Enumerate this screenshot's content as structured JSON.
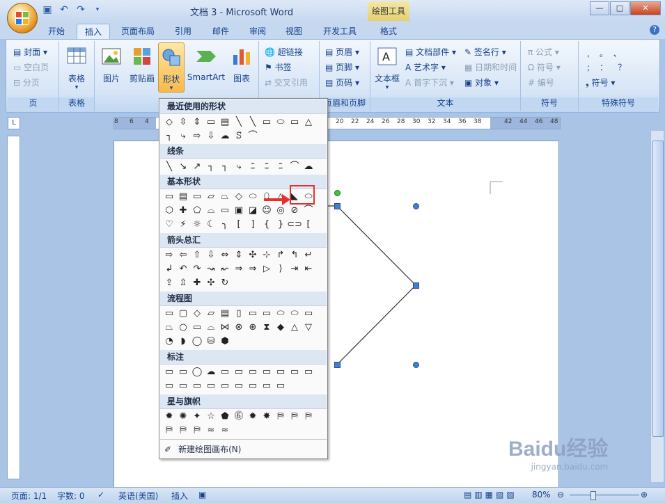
{
  "window": {
    "title": "文档 3 - Microsoft Word",
    "context_tab": "绘图工具"
  },
  "ribbon_tabs": [
    "开始",
    "插入",
    "页面布局",
    "引用",
    "邮件",
    "审阅",
    "视图",
    "开发工具",
    "格式"
  ],
  "ribbon": {
    "groups": {
      "pages": {
        "label": "页",
        "items": [
          "封面",
          "空白页",
          "分页"
        ]
      },
      "tables": {
        "label": "表格",
        "button": "表格"
      },
      "illustrations": {
        "buttons": [
          "图片",
          "剪贴画",
          "形状",
          "SmartArt",
          "图表"
        ]
      },
      "links": {
        "items": [
          "超链接",
          "书签",
          "交叉引用"
        ]
      },
      "header_footer": {
        "label": "页眉和页脚",
        "items": [
          "页眉",
          "页脚",
          "页码"
        ]
      },
      "text": {
        "label": "文本",
        "button": "文本框",
        "items": [
          "文档部件",
          "艺术字",
          "首字下沉",
          "签名行",
          "日期和时间",
          "对象"
        ]
      },
      "symbols": {
        "label": "符号",
        "items": [
          "公式",
          "符号",
          "编号"
        ]
      },
      "special": {
        "label": "特殊符号",
        "chars": [
          ",",
          "。",
          "、",
          ";",
          "：",
          "？"
        ],
        "button": "符号"
      }
    }
  },
  "ruler": {
    "numbers": [
      "8",
      "6",
      "4",
      "20",
      "22",
      "24",
      "26",
      "28",
      "30",
      "32",
      "34",
      "36",
      "38",
      "42",
      "44",
      "46",
      "48"
    ]
  },
  "shapes_menu": {
    "sections": [
      "最近使用的形状",
      "线条",
      "基本形状",
      "箭头总汇",
      "流程图",
      "标注",
      "星与旗帜"
    ],
    "recent": [
      "◇",
      "⇳",
      "⇕",
      "▭",
      "▤",
      "╲",
      "╲",
      "▭",
      "⬭",
      "▭",
      "△",
      "┐",
      "⤷",
      "⇨",
      "⇩",
      "☁",
      "ꕶ",
      "⌒"
    ],
    "lines": [
      "╲",
      "↘",
      "↗",
      "┐",
      "┐",
      "⤷",
      "ﾆ",
      "ﾆ",
      "ﾆ",
      "⌒",
      "☁",
      "ꕶ"
    ],
    "basic": [
      "▭",
      "▤",
      "▭",
      "▱",
      "⏢",
      "◇",
      "⬭",
      "⬯",
      "△",
      "◣",
      "⬭",
      "⬡",
      "✚",
      "⬠",
      "⌓",
      "▭",
      "▣",
      "◪",
      "☺",
      "◎",
      "⊘",
      "⌒",
      "♡",
      "⚡",
      "☼",
      "☾",
      "╮",
      "[",
      "]",
      "{",
      "}",
      "⊂⊃",
      "[",
      "]",
      "{",
      "}"
    ],
    "arrows": [
      "⇨",
      "⇦",
      "⇧",
      "⇩",
      "⇔",
      "⇕",
      "✣",
      "⊹",
      "↱",
      "↰",
      "↵",
      "↲",
      "↶",
      "↷",
      "↝",
      "↜",
      "⇒",
      "⇒",
      "▷",
      "⟩",
      "⇥",
      "⇤",
      "⇪",
      "⇫",
      "✚",
      "✣",
      "↻"
    ],
    "flowchart": [
      "▭",
      "▢",
      "◇",
      "▱",
      "▤",
      "▯",
      "▭",
      "▭",
      "⬭",
      "⬭",
      "▭",
      "⏢",
      "○",
      "▭",
      "⌓",
      "⋈",
      "⊗",
      "⊕",
      "⧗",
      "◆",
      "△",
      "▽",
      "◔",
      "◗",
      "◯",
      "⛁",
      "⬢"
    ],
    "callouts": [
      "▭",
      "▭",
      "◯",
      "☁",
      "▭",
      "▭",
      "▭",
      "▭",
      "▭",
      "▭",
      "▭",
      "▭",
      "▭",
      "▭",
      "▭",
      "▭",
      "▭",
      "▭",
      "▭",
      "▭"
    ],
    "stars": [
      "✹",
      "✺",
      "✦",
      "☆",
      "⬟",
      "⓺",
      "✹",
      "✸",
      "⛿",
      "⛿",
      "⛿",
      "⛿",
      "⛿",
      "⛿",
      "≈",
      "≈"
    ],
    "new_canvas": "新建绘图画布(N)"
  },
  "status": {
    "page": "页面: 1/1",
    "words": "字数: 0",
    "language": "英语(美国)",
    "mode": "插入",
    "zoom": "80%"
  },
  "watermark": {
    "brand": "Baidu经验",
    "url": "jingyan.baidu.com"
  }
}
